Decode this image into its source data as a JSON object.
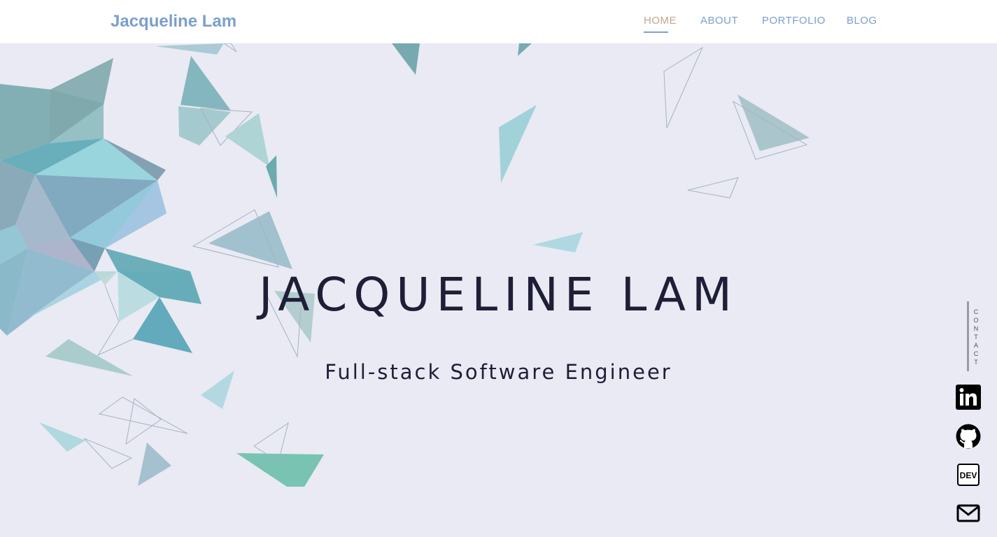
{
  "header": {
    "brand": "Jacqueline Lam",
    "nav": [
      "HOME",
      "ABOUT",
      "PORTFOLIO",
      "BLOG"
    ],
    "active_nav": "HOME"
  },
  "hero": {
    "title": "JACQUELINE LAM",
    "subtitle": "Full-stack Software Engineer"
  },
  "sidebar": {
    "contact_label": "CONTACT",
    "social_icons": [
      "linkedin-icon",
      "github-icon",
      "dev-icon",
      "mail-icon"
    ]
  },
  "colors": {
    "background": "#e9eaf3",
    "header_bg": "#ffffff",
    "brand": "#7a9fcc",
    "nav": "#7a9fcc",
    "nav_active": "#c4a592",
    "title_text": "#1e1e37"
  }
}
